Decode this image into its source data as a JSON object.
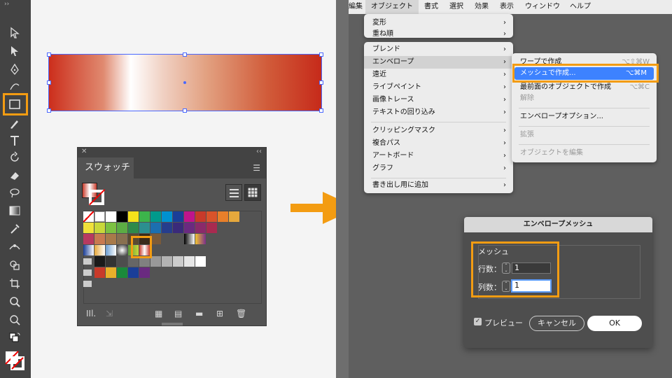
{
  "toolbar": {
    "tools": [
      "selection-icon",
      "direct-selection-icon",
      "pen-icon",
      "curvature-icon",
      "rectangle-icon",
      "brush-icon",
      "type-icon",
      "rotate-icon",
      "eraser-icon",
      "lasso-icon",
      "gradient-icon",
      "eyedropper-icon",
      "width-icon",
      "shape-builder-icon",
      "crop-icon",
      "zoom-icon",
      "paint-bucket-icon"
    ]
  },
  "swatches_panel": {
    "tab_label": "スウォッチ",
    "colors_row1": [
      "#ffffff",
      "#000000",
      "#f4e11b",
      "#3cb44b",
      "#009a8c",
      "#0091d0",
      "#1a3e98",
      "#c0148c",
      "#c83a2a",
      "#d9532a",
      "#e87f2a",
      "#e6a83c"
    ],
    "colors_row2": [
      "#f0e13a",
      "#c8d83a",
      "#7cc142",
      "#5cac44",
      "#2f8a4a",
      "#2c8f8f",
      "#1c6fb0",
      "#263d8c",
      "#3a2a7a",
      "#6a2a80",
      "#8a2a6a",
      "#a82a50"
    ],
    "colors_row3": [
      "#b83a60",
      "#c87a50",
      "#a87a4a",
      "#887050",
      "#5a4a30",
      "#3a2a1a",
      "#7a5a3a"
    ],
    "grays": [
      "#1a1a1a",
      "#333333",
      "#4d4d4d",
      "#666666",
      "#808080",
      "#999999",
      "#b3b3b3",
      "#cccccc",
      "#e6e6e6",
      "#ffffff"
    ],
    "group2": [
      "#c83a2a",
      "#e8b02a",
      "#1a8a3a",
      "#1a3e98",
      "#6a2a80"
    ]
  },
  "menubar": {
    "items": [
      "編集",
      "オブジェクト",
      "書式",
      "選択",
      "効果",
      "表示",
      "ウィンドウ",
      "ヘルプ"
    ]
  },
  "object_menu": {
    "items": [
      {
        "label": "変形",
        "sub": true
      },
      {
        "label": "重ね順",
        "sub": true
      },
      {
        "label": "ブレンド",
        "sub": true
      },
      {
        "label": "エンベロープ",
        "sub": true
      },
      {
        "label": "遠近",
        "sub": true
      },
      {
        "label": "ライブペイント",
        "sub": true
      },
      {
        "label": "画像トレース",
        "sub": true
      },
      {
        "label": "テキストの回り込み",
        "sub": true
      },
      {
        "label": "クリッピングマスク",
        "sub": true
      },
      {
        "label": "複合パス",
        "sub": true
      },
      {
        "label": "アートボード",
        "sub": true
      },
      {
        "label": "グラフ",
        "sub": true
      },
      {
        "label": "書き出し用に追加",
        "sub": true
      }
    ]
  },
  "envelope_submenu": {
    "items": [
      {
        "label": "ワープで作成",
        "shortcut": "⌥⇧⌘W"
      },
      {
        "label": "メッシュで作成...",
        "shortcut": "⌥⌘M"
      },
      {
        "label": "最前面のオブジェクトで作成",
        "shortcut": "⌥⌘C"
      },
      {
        "label": "解除",
        "shortcut": ""
      },
      {
        "label": "エンベロープオプション...",
        "shortcut": ""
      },
      {
        "label": "拡張",
        "shortcut": ""
      },
      {
        "label": "オブジェクトを編集",
        "shortcut": ""
      }
    ]
  },
  "dialog": {
    "title": "エンベロープメッシュ",
    "group_label": "メッシュ",
    "rows_label": "行数：",
    "rows_value": "1",
    "cols_label": "列数：",
    "cols_value": "1",
    "preview_label": "プレビュー",
    "preview_checked": true,
    "cancel_label": "キャンセル",
    "ok_label": "OK"
  },
  "colors": {
    "highlight": "#f39c12",
    "menu_selection": "#3d82ff",
    "arrow": "#f39c12"
  }
}
